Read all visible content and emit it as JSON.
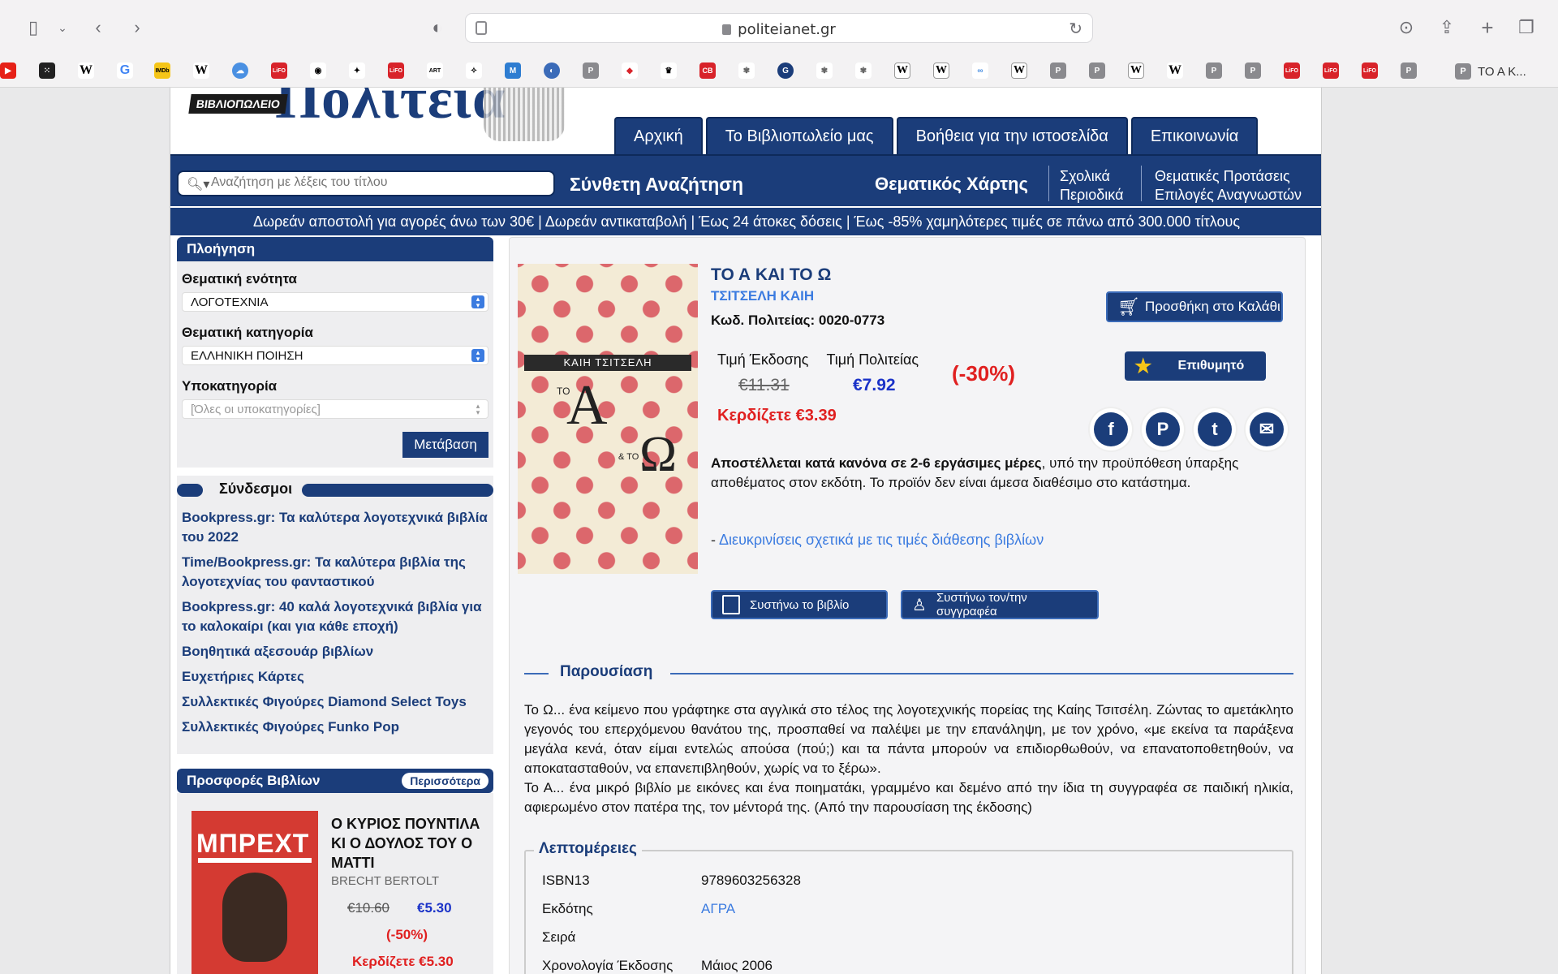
{
  "browser": {
    "url": "politeianet.gr",
    "tab_label": "ΤΟ Α Κ..."
  },
  "site": {
    "logo_badge": "ΒΙΒΛΙΟΠΩΛΕΙΟ",
    "logo_name": "Πολιτεία",
    "nav": [
      "Αρχική",
      "Το Βιβλιοπωλείο μας",
      "Βοήθεια για την ιστοσελίδα",
      "Επικοινωνία"
    ],
    "search_placeholder": "Αναζήτηση με λέξεις του τίτλου",
    "advanced_search": "Σύνθετη Αναζήτηση",
    "thematic_map": "Θεματικός Χάρτης",
    "school": "Σχολικά",
    "periodicals": "Περιοδικά",
    "thematic_proposals": "Θεματικές Προτάσεις",
    "reader_choices": "Επιλογές Αναγνωστών",
    "promo": "Δωρεάν αποστολή για αγορές άνω των 30€ | Δωρεάν αντικαταβολή | Έως 24 άτοκες δόσεις | Έως -85% χαμηλότερες τιμές σε πάνω από 300.000 τίτλους"
  },
  "sidebar": {
    "nav_title": "Πλοήγηση",
    "section_label": "Θεματική ενότητα",
    "section_value": "ΛΟΓΟΤΕΧΝΙΑ",
    "category_label": "Θεματική κατηγορία",
    "category_value": "ΕΛΛΗΝΙΚΗ ΠΟΙΗΣΗ",
    "subcategory_label": "Υποκατηγορία",
    "subcategory_value": "[Όλες οι υποκατηγορίες]",
    "go_button": "Μετάβαση",
    "links_title": "Σύνδεσμοι",
    "links": [
      "Bookpress.gr: Τα καλύτερα λογοτεχνικά βιβλία του 2022",
      "Time/Bookpress.gr: Τα καλύτερα βιβλία της λογοτεχνίας του φανταστικού",
      "Bookpress.gr: 40 καλά λογοτεχνικά βιβλία για το καλοκαίρι (και για κάθε εποχή)",
      "Βοηθητικά αξεσουάρ βιβλίων",
      "Ευχετήριες Κάρτες",
      "Συλλεκτικές Φιγούρες Diamond Select Toys",
      "Συλλεκτικές Φιγούρες Funko Pop"
    ],
    "offers_title": "Προσφορές Βιβλίων",
    "offers_more": "Περισσότερα",
    "offer": {
      "cover_text": "ΜΠΡΕΧΤ",
      "title": "Ο ΚΥΡΙΟΣ ΠΟΥΝΤΙΛΑ ΚΙ Ο ΔΟΥΛΟΣ ΤΟΥ Ο ΜΑΤΤΙ",
      "author": "BRECHT BERTOLT",
      "old_price": "€10.60",
      "new_price": "€5.30",
      "discount": "(-50%)",
      "save": "Κερδίζετε €5.30"
    }
  },
  "product": {
    "cover_author": "ΚΑΙΗ ΤΣΙΤΣΕΛΗ",
    "cover_a": "Α",
    "cover_o": "Ω",
    "cover_to1": "ΤΟ",
    "cover_to2": "& ΤΟ",
    "title": "ΤΟ Α ΚΑΙ ΤΟ Ω",
    "author": "ΤΣΙΤΣΕΛΗ ΚΑΙΗ",
    "code": "Κωδ. Πολιτείας: 0020-0773",
    "price_label_publisher": "Τιμή Έκδοσης",
    "price_label_politeia": "Τιμή Πολιτείας",
    "old_price": "€11.31",
    "new_price": "€7.92",
    "discount": "(-30%)",
    "save": "Κερδίζετε €3.39",
    "add_to_cart": "Προσθήκη στο Καλάθι",
    "wishlist": "Επιθυμητό",
    "shipping_bold": "Αποστέλλεται κατά κανόνα σε 2-6 εργάσιμες μέρες",
    "shipping_rest": ", υπό την προϋπόθεση ύπαρξης αποθέματος στον εκδότη. Το προϊόν δεν είναι άμεσα διαθέσιμο στο κατάστημα.",
    "clarif_prefix": "- ",
    "clarif_link": "Διευκρινίσεις σχετικά με τις τιμές διάθεσης βιβλίων",
    "recommend_book": "Συστήνω το βιβλίο",
    "recommend_author": "Συστήνω τον/την συγγραφέα",
    "presentation_title": "Παρουσίαση",
    "presentation_text": "Το Ω... ένα κείμενο που γράφτηκε στα αγγλικά στο τέλος της λογοτεχνικής πορείας της Καίης Τσιτσέλη. Ζώντας το αμετάκλητο γεγονός του επερχόμενου θανάτου της, προσπαθεί να παλέψει με την επανάληψη, με τον χρόνο, «με εκείνα τα παράξενα μεγάλα κενά, όταν είμαι εντελώς απούσα (πού;) και τα πάντα μπορούν να επιδιορθωθούν, να επανατοποθετηθούν, να αποκατασταθούν, να επανεπιβληθούν, χωρίς να το ξέρω».",
    "presentation_text2": "Το Α... ένα μικρό βιβλίο με εικόνες και ένα ποιηματάκι, γραμμένο και δεμένο από την ίδια τη συγγραφέα σε παιδική ηλικία, αφιερωμένο στον πατέρα της, τον μέντορά της. (Από την παρουσίαση της έκδοσης)",
    "details_title": "Λεπτομέρειες",
    "details": [
      {
        "k": "ISBN13",
        "v": "9789603256328"
      },
      {
        "k": "Εκδότης",
        "v": "ΑΓΡΑ"
      },
      {
        "k": "Σειρά",
        "v": ""
      },
      {
        "k": "Χρονολογία Έκδοσης",
        "v": "Μάιος 2006"
      }
    ]
  },
  "colors": {
    "brand": "#1b3d7a",
    "price_red": "#e02020",
    "price_blue": "#1a32c8"
  }
}
